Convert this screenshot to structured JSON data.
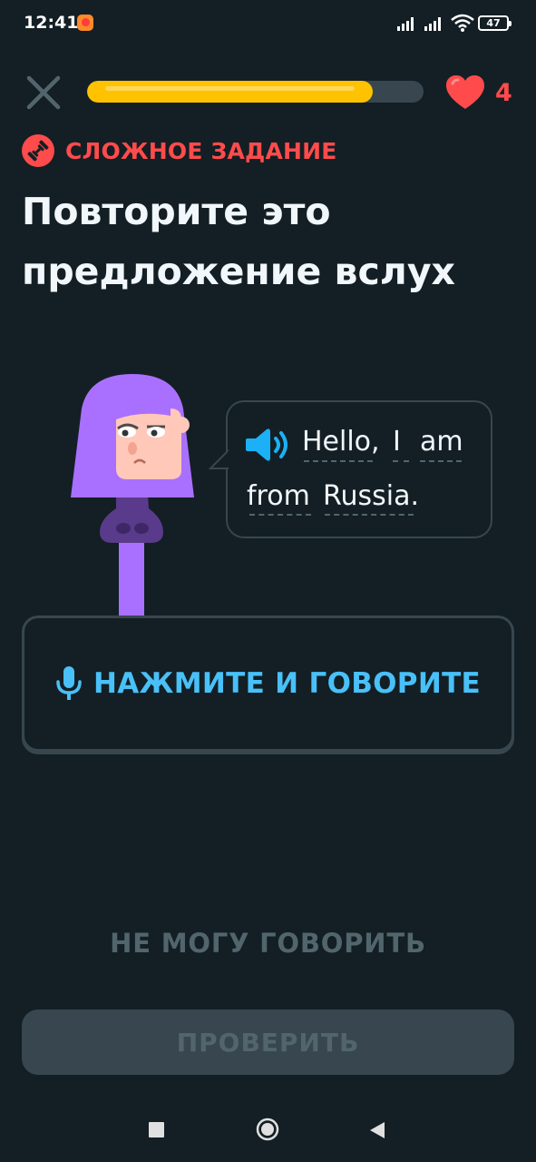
{
  "status_bar": {
    "time": "12:41",
    "battery": "47",
    "icons": [
      "app-notification-icon",
      "signal-icon",
      "signal-icon",
      "wifi-icon",
      "battery-icon"
    ]
  },
  "header": {
    "close_icon": "close-icon",
    "progress_fraction": 0.85,
    "hearts_count": "4",
    "heart_icon": "heart-icon"
  },
  "challenge": {
    "badge_icon": "dumbbell-icon",
    "badge_label": "СЛОЖНОЕ ЗАДАНИЕ",
    "title": "Повторите это предложение вслух"
  },
  "speech": {
    "speaker_icon": "speaker-icon",
    "words": [
      "Hello,",
      "I",
      "am",
      "from",
      "Russia."
    ]
  },
  "speak_button": {
    "icon": "microphone-icon",
    "label": "НАЖМИТЕ И ГОВОРИТЕ"
  },
  "cant_speak_label": "НЕ МОГУ ГОВОРИТЬ",
  "check_button_label": "ПРОВЕРИТЬ",
  "nav_bar": {
    "icons": [
      "recents-square-icon",
      "home-circle-icon",
      "back-triangle-icon"
    ]
  },
  "colors": {
    "background": "#131f24",
    "progress": "#ffc200",
    "accent_red": "#ff4b4b",
    "accent_blue": "#49c0f8",
    "character_hair": "#a970ff",
    "disabled": "#37464f",
    "disabled_text": "#52656d"
  }
}
